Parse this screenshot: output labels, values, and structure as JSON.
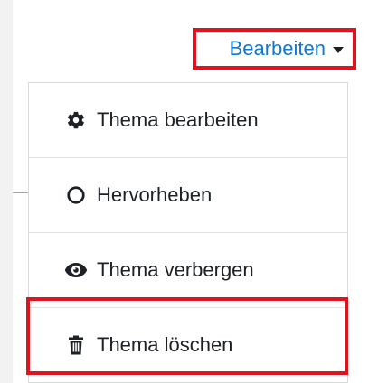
{
  "trigger": {
    "label": "Bearbeiten",
    "caret_icon": "caret-down-icon"
  },
  "menu": {
    "items": [
      {
        "label": "Thema bearbeiten",
        "icon": "gear-icon"
      },
      {
        "label": "Hervorheben",
        "icon": "circle-outline-icon"
      },
      {
        "label": "Thema verbergen",
        "icon": "eye-icon"
      },
      {
        "label": "Thema löschen",
        "icon": "trash-icon"
      }
    ]
  },
  "colors": {
    "link": "#1177d1",
    "highlight_border": "#e0141e",
    "text": "#1d2125"
  }
}
